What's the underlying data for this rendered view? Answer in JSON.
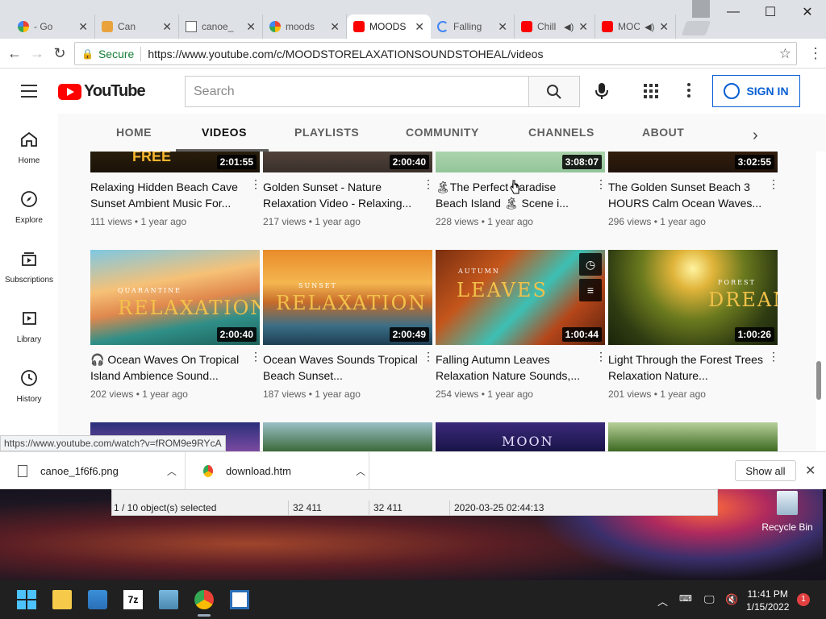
{
  "browser": {
    "tabs": [
      {
        "title": "- Go",
        "favicon": "google-icon"
      },
      {
        "title": "Can",
        "favicon": "canva-icon"
      },
      {
        "title": "canoe_",
        "favicon": "file-icon"
      },
      {
        "title": "moods",
        "favicon": "google-icon"
      },
      {
        "title": "MOODS",
        "favicon": "youtube-icon",
        "active": true
      },
      {
        "title": "Falling",
        "favicon": "loading-icon"
      },
      {
        "title": "Chill",
        "favicon": "youtube-icon"
      },
      {
        "title": "MOC",
        "favicon": "youtube-icon"
      }
    ],
    "address": {
      "secure_label": "Secure",
      "url": "https://www.youtube.com/c/MOODSTORELAXATIONSOUNDSTOHEAL/videos"
    },
    "status_url": "https://www.youtube.com/watch?v=fROM9e9RYcA"
  },
  "youtube": {
    "logo_text": "YouTube",
    "search_placeholder": "Search",
    "sign_in_label": "SIGN IN",
    "guide": [
      {
        "label": "Home",
        "icon": "home-icon"
      },
      {
        "label": "Explore",
        "icon": "compass-icon"
      },
      {
        "label": "Subscriptions",
        "icon": "subscriptions-icon"
      },
      {
        "label": "Library",
        "icon": "library-icon"
      },
      {
        "label": "History",
        "icon": "history-icon"
      }
    ],
    "channel_tabs": [
      "HOME",
      "VIDEOS",
      "PLAYLISTS",
      "COMMUNITY",
      "CHANNELS",
      "ABOUT"
    ],
    "active_tab": "VIDEOS",
    "videos_row1": [
      {
        "title": "Relaxing Hidden Beach Cave Sunset Ambient Music For...",
        "duration": "2:01:55",
        "meta": "111 views • 1 year ago",
        "thumb_text": "FREE"
      },
      {
        "title": "Golden Sunset - Nature Relaxation Video - Relaxing...",
        "duration": "2:00:40",
        "meta": "217 views • 1 year ago"
      },
      {
        "title": "🏝The Perfect Paradise Beach Island 🏝 Scene i...",
        "duration": "3:08:07",
        "meta": "228 views • 1 year ago"
      },
      {
        "title": "The Golden Sunset Beach 3 HOURS Calm Ocean Waves...",
        "duration": "3:02:55",
        "meta": "296 views • 1 year ago"
      }
    ],
    "videos_row2": [
      {
        "title": "🎧 Ocean Waves On Tropical Island Ambience Sound...",
        "duration": "2:00:40",
        "meta": "202 views • 1 year ago",
        "thumb_small": "QUARANTINE",
        "thumb_text": "RELAXATION"
      },
      {
        "title": "Ocean Waves Sounds Tropical Beach Sunset...",
        "duration": "2:00:49",
        "meta": "187 views • 1 year ago",
        "thumb_small": "SUNSET",
        "thumb_text": "RELAXATION"
      },
      {
        "title": "Falling Autumn Leaves Relaxation Nature Sounds,...",
        "duration": "1:00:44",
        "meta": "254 views • 1 year ago",
        "thumb_small": "AUTUMN",
        "thumb_text": "LEAVES"
      },
      {
        "title": "Light Through the Forest Trees Relaxation Nature...",
        "duration": "1:00:26",
        "meta": "201 views • 1 year ago",
        "thumb_small": "FOREST",
        "thumb_text": "DREAMS"
      }
    ],
    "row3_thumb_text": "MOON"
  },
  "downloads": [
    {
      "name": "canoe_1f6f6.png",
      "icon": "file-icon"
    },
    {
      "name": "download.htm",
      "icon": "chrome-icon"
    }
  ],
  "downloads_show_all": "Show all",
  "explorer_status": {
    "selection": "1 / 10 object(s) selected",
    "size1": "32 411",
    "size2": "32 411",
    "date": "2020-03-25 02:44:13"
  },
  "desktop": {
    "recycle_bin": "Recycle Bin"
  },
  "taskbar": {
    "time": "11:41 PM",
    "date": "1/15/2022",
    "notifications": "1"
  }
}
